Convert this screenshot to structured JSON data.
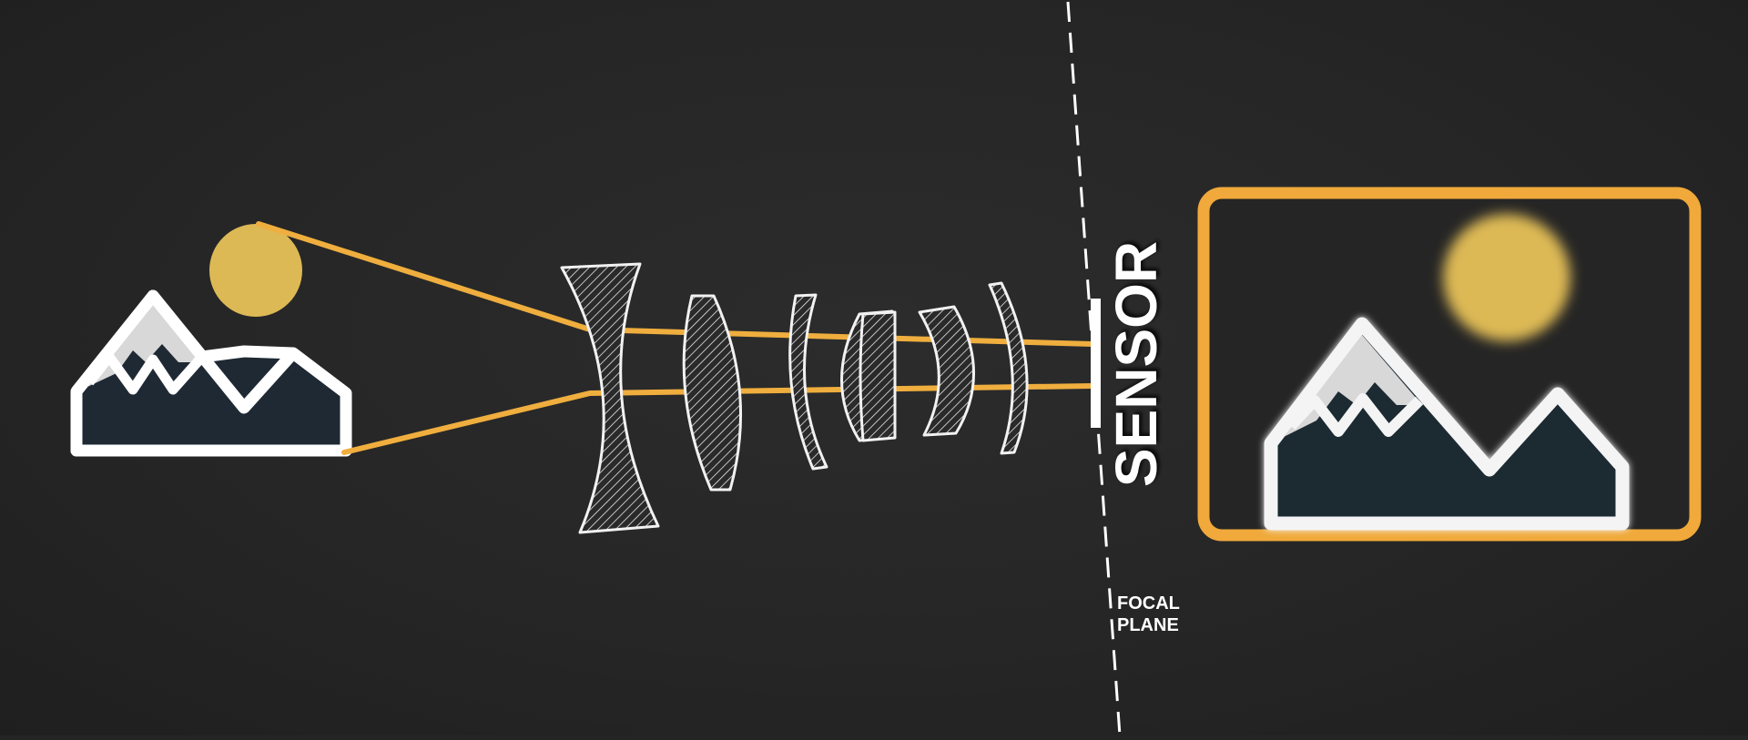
{
  "labels": {
    "sensor": "SENSOR",
    "focal_plane_line1": "FOCAL",
    "focal_plane_line2": "PLANE"
  },
  "colors": {
    "background": "#252525",
    "ray": "#EFAE3E",
    "sun": "#DDB955",
    "mountain_fill": "#1E2933",
    "snow": "#D8D8D8",
    "outline": "#FFFFFF",
    "frame": "#F0A93A"
  },
  "icons": {
    "subject": "landscape-icon",
    "result": "landscape-photo-icon"
  }
}
